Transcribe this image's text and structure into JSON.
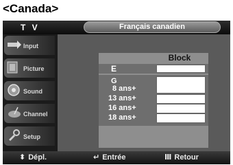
{
  "page_label": "<Canada>",
  "header": {
    "title": "T V",
    "language": "Français canadien"
  },
  "sidebar": {
    "items": [
      {
        "label": "Input",
        "icon": "input-icon"
      },
      {
        "label": "Picture",
        "icon": "picture-icon"
      },
      {
        "label": "Sound",
        "icon": "sound-icon"
      },
      {
        "label": "Channel",
        "icon": "channel-icon"
      },
      {
        "label": "Setup",
        "icon": "setup-icon"
      }
    ]
  },
  "block_table": {
    "header": "Block",
    "rows": [
      {
        "label": "E"
      },
      {
        "label": "G"
      },
      {
        "label": "8 ans+"
      },
      {
        "label": "13 ans+"
      },
      {
        "label": "16 ans+"
      },
      {
        "label": "18 ans+"
      }
    ]
  },
  "footer": {
    "move": {
      "glyph": "⬍",
      "label": "Dépl."
    },
    "enter": {
      "glyph": "↵",
      "label": "Entrée"
    },
    "back": {
      "glyph": "Ⅲ",
      "label": "Retour"
    }
  },
  "colors": {
    "accent": "#9a9a9a",
    "background": "#1b1b1b"
  }
}
